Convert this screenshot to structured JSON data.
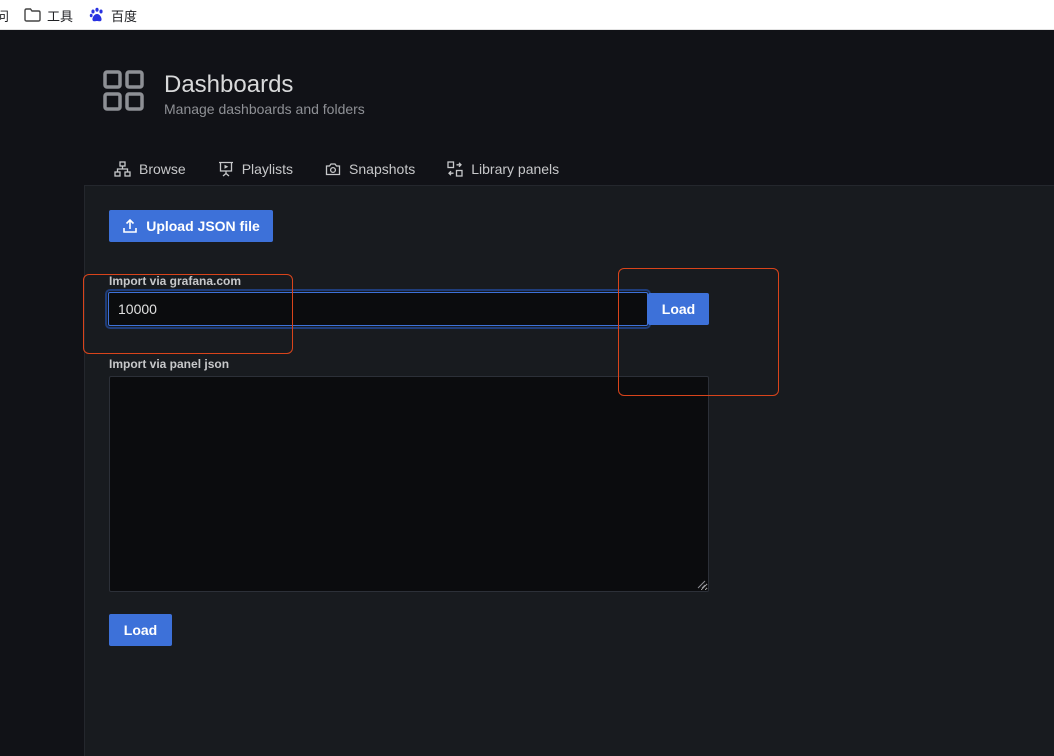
{
  "bookmarks": {
    "cut_label": "问",
    "tools_label": "工具",
    "baidu_label": "百度"
  },
  "header": {
    "icon": "apps-grid-icon",
    "title": "Dashboards",
    "subtitle": "Manage dashboards and folders"
  },
  "tabs": [
    {
      "label": "Browse",
      "icon": "sitemap-icon"
    },
    {
      "label": "Playlists",
      "icon": "presentation-play-icon"
    },
    {
      "label": "Snapshots",
      "icon": "camera-icon"
    },
    {
      "label": "Library panels",
      "icon": "library-panel-icon"
    }
  ],
  "import": {
    "upload_label": "Upload JSON file",
    "grafana_label": "Import via grafana.com",
    "grafana_value": "10000",
    "load_label": "Load",
    "panel_json_label": "Import via panel json",
    "panel_json_value": "",
    "load_label_2": "Load"
  },
  "colors": {
    "accent": "#3d71d9",
    "background": "#111217",
    "panel": "#181b1f",
    "annotation": "#d9441b"
  }
}
